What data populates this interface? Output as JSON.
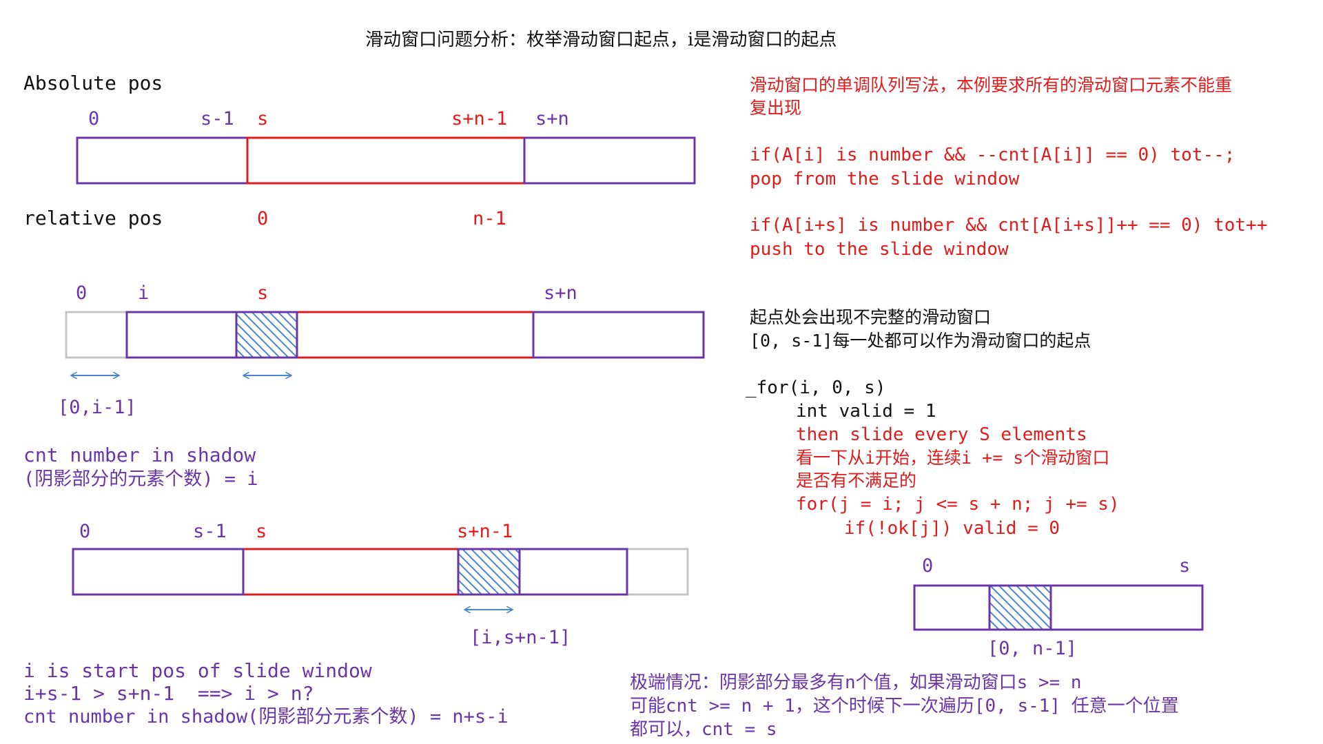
{
  "colors": {
    "purple": "#6a35a8",
    "red": "#e01b1b",
    "gray": "#c4c4c4",
    "hatch": "#4a86d0",
    "black": "#111111"
  },
  "title": "滑动窗口问题分析：枚举滑动窗口起点，i是滑动窗口的起点",
  "diagram1": {
    "absolute_label": "Absolute pos",
    "ticks": [
      "0",
      "s-1",
      "s",
      "s+n-1",
      "s+n"
    ],
    "relative_label": "relative pos",
    "relative_ticks": [
      "0",
      "n-1"
    ]
  },
  "diagram2": {
    "ticks": [
      "0",
      "i",
      "s",
      "s+n"
    ],
    "range_label": "[0,i-1]"
  },
  "shadow_note": {
    "line1": "cnt number in shadow",
    "line2": "(阴影部分的元素个数) = i"
  },
  "diagram3": {
    "ticks": [
      "0",
      "s-1",
      "s",
      "s+n-1"
    ],
    "range_label": "[i,s+n-1]"
  },
  "bottom_left": {
    "line1": "i is start pos of slide window",
    "line2": "i+s-1 > s+n-1  ==> i > n?",
    "line3": "cnt number in shadow(阴影部分元素个数) = n+s-i"
  },
  "right_notes": {
    "intro1": "滑动窗口的单调队列写法，本例要求所有的滑动窗口元素不能重",
    "intro2": "复出现",
    "code1": "if(A[i] is number && --cnt[A[i]] == 0) tot--;",
    "code1_note": "pop from the slide window",
    "code2": "if(A[i+s] is number && cnt[A[i+s]]++ == 0) tot++",
    "code2_note": "push to the slide window",
    "start1": "起点处会出现不完整的滑动窗口",
    "start2": "[0, s-1]每一处都可以作为滑动窗口的起点",
    "loop1": "_for(i, 0, s)",
    "loop2": "int valid = 1",
    "loop3": "then slide every S elements",
    "loop4": "看一下从i开始，连续i += s个滑动窗口",
    "loop5": "是否有不满足的",
    "loop6": "for(j = i; j <= s + n; j += s)",
    "loop7": "if(!ok[j]) valid = 0"
  },
  "diagram4": {
    "ticks": [
      "0",
      "s"
    ],
    "range_label": "[0, n-1]"
  },
  "extreme": {
    "line1": "极端情况：阴影部分最多有n个值，如果滑动窗口s >= n",
    "line2": "可能cnt >= n + 1，这个时候下一次遍历[0, s-1] 任意一个位置",
    "line3": "都可以，cnt = s"
  }
}
